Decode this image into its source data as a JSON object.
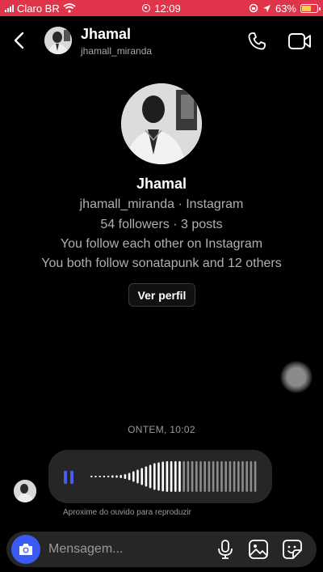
{
  "status_bar": {
    "carrier": "Claro BR",
    "time": "12:09",
    "battery": "63%",
    "battery_level": 0.63,
    "color": "#e0344a"
  },
  "header": {
    "name": "Jhamal",
    "handle": "jhamall_miranda",
    "icons": [
      "back-icon",
      "phone-icon",
      "video-camera-icon"
    ]
  },
  "profile": {
    "name": "Jhamal",
    "handle_line": "jhamall_miranda · Instagram",
    "stats_line": "54 followers · 3 posts",
    "follow_line": "You follow each other on Instagram",
    "mutual_line": "You both follow sonatapunk and 12 others",
    "view_profile_label": "Ver perfil"
  },
  "chat": {
    "timestamp": "ONTEM, 10:02",
    "audio_message": {
      "state": "playing",
      "accent_color": "#4a5cf0",
      "hint": "Aproxime do ouvido para reproduzir"
    }
  },
  "composer": {
    "placeholder": "Mensagem...",
    "camera_color": "#3b5bf5",
    "icons": [
      "camera-icon",
      "microphone-icon",
      "image-icon",
      "sticker-icon"
    ]
  }
}
